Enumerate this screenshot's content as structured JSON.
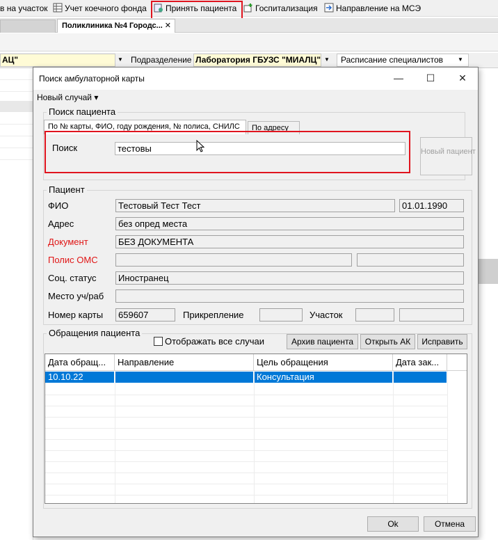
{
  "toolbar": {
    "items": [
      {
        "label": "в на участок"
      },
      {
        "label": "Учет коечного фонда"
      },
      {
        "label": "Принять пациента"
      },
      {
        "label": "Госпитализация"
      },
      {
        "label": "Направление на МСЭ"
      }
    ]
  },
  "tabs": {
    "active_label": "Поликлиника №4 Городс...",
    "close": "✕"
  },
  "filter": {
    "left_value": "АЦ\"",
    "division_label": "Подразделение",
    "division_value": "Лаборатория ГБУЗС \"МИАЛЦ\"",
    "schedule_label": "Расписание специалистов",
    "arrow": "▼"
  },
  "dialog": {
    "title": "Поиск амбулаторной карты",
    "minimize": "—",
    "maximize": "☐",
    "close": "✕",
    "menu_label": "Новый случай ▾",
    "search_group": {
      "title": "Поиск пациента",
      "tab_1": "По № карты, ФИО, году рождения, № полиса, СНИЛС",
      "tab_2": "По адресу",
      "search_label": "Поиск",
      "search_value": "тестовы",
      "new_patient_button": "Новый пациент"
    },
    "patient_group": {
      "title": "Пациент",
      "fio_label": "ФИО",
      "fio_value": "Тестовый Тест Тест",
      "birth_date": "01.01.1990",
      "address_label": "Адрес",
      "address_value": "без опред места",
      "document_label": "Документ",
      "document_value": "БЕЗ ДОКУМЕНТА",
      "policy_label": "Полис ОМС",
      "policy_value": "",
      "policy_value_2": "",
      "social_label": "Соц. статус",
      "social_value": "Иностранец",
      "work_label": "Место уч/раб",
      "work_value": "",
      "card_label": "Номер карты",
      "card_value": "659607",
      "attach_label": "Прикрепление",
      "attach_value": "",
      "district_label": "Участок",
      "district_value": "",
      "district_value_2": ""
    },
    "visits_group": {
      "title": "Обращения пациента",
      "show_all_label": "Отображать все случаи",
      "show_all_checked": false,
      "archive_button": "Архив пациента",
      "open_ak_button": "Открыть АК",
      "edit_button": "Исправить",
      "columns": [
        "Дата обращ...",
        "Направление",
        "Цель обращения",
        "Дата зак..."
      ],
      "rows": [
        [
          "10.10.22",
          "",
          "Консультация",
          ""
        ]
      ]
    },
    "ok_button": "Ok",
    "cancel_button": "Отмена"
  },
  "colors": {
    "highlight": "#e0141e",
    "selection": "#0078d7",
    "required_label": "#e01515"
  }
}
